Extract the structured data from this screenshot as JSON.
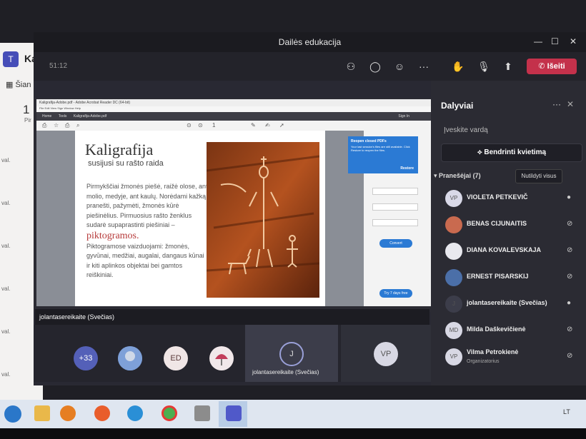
{
  "background_app": {
    "logo_icon": "teams-logo-icon",
    "title_fragment": "Ka",
    "nav_label": "Šian",
    "date_number": "1",
    "weekday_fragment": "Pir",
    "time_labels": [
      "val.",
      "val.",
      "val.",
      "val.",
      "val.",
      "val."
    ]
  },
  "meeting": {
    "window_title": "Dailės edukacija",
    "timer": "51:12",
    "leave_label": "Išeiti",
    "toolbar_icons": [
      "people-icon",
      "chat-icon",
      "reactions-icon",
      "more-icon",
      "raise-hand-icon",
      "mic-icon",
      "share-icon"
    ]
  },
  "shared_screen": {
    "acrobat_title": "Kaligrafija-Adobe.pdf - Adobe Acrobat Reader DC (64-bit)",
    "acrobat_menu": "File  Edit  View  Sign  Window  Help",
    "tabs": [
      "Home",
      "Tools",
      "Kaligrafija-Adobe.pdf"
    ],
    "sign_in": "Sign In",
    "page_indicator": "1",
    "slide": {
      "title": "Kaligrafija",
      "subtitle": "susijusi su rašto raida",
      "paragraph1": "Pirmykščiai žmonės piešė, raižė olose, ant molio, medyje, ant kaulų. Norėdami kažką pranešti, pažymėti, žmonės kūrė piešinėlius. Pirmuosius rašto ženklus sudarė supaprastinti piešiniai –",
      "highlight": "piktogramos.",
      "paragraph2": "Piktogramose vaizduojami: žmonės, gyvūnai, medžiai, augalai, dangaus kūnai ir kiti aplinkos objektai bei gamtos reiškiniai."
    },
    "popup": {
      "title": "Reopen closed PDFs",
      "body": "Your last session's files are still available. Click Restore to reopen the files.",
      "restore": "Restore"
    },
    "right_panel_button": "Convert",
    "right_panel_button2": "Try 7 days free",
    "presenter_label": "jolantasereikaite (Svečias)"
  },
  "gallery": {
    "overflow_count": "+33",
    "ed_initials": "ED",
    "active_initial": "J",
    "active_name": "jolantasereikaite (Svečias)",
    "vp_initials": "VP"
  },
  "participants": {
    "title": "Dalyviai",
    "more": "···",
    "close": "✕",
    "search_placeholder": "Įveskite vardą",
    "share_invite": "Bendrinti kvietimą",
    "presenters_header": "Pranešėjai (7)",
    "mute_all": "Nutildyti visus",
    "people": [
      {
        "initials": "VP",
        "name": "VIOLETA PETKEVIČ",
        "role": "",
        "mic": "mic-on-icon",
        "avatar_color": "#d9d9e8"
      },
      {
        "initials": "",
        "name": "BENAS CIJUNAITIS",
        "role": "",
        "mic": "mic-off-icon",
        "avatar_color": "#c96a4f"
      },
      {
        "initials": "",
        "name": "DIANA KOVALEVSKAJA",
        "role": "",
        "mic": "mic-off-icon",
        "avatar_color": "#e8e8ee"
      },
      {
        "initials": "",
        "name": "ERNEST PISARSKIJ",
        "role": "",
        "mic": "mic-off-icon",
        "avatar_color": "#4b6fa8"
      },
      {
        "initials": "J",
        "name": "jolantasereikaite (Svečias)",
        "role": "",
        "mic": "mic-on-icon",
        "avatar_color": "#3c3d4a"
      },
      {
        "initials": "MD",
        "name": "Milda Daškevičienė",
        "role": "",
        "mic": "mic-off-icon",
        "avatar_color": "#d8d8e4"
      },
      {
        "initials": "VP",
        "name": "Vilma Petrokienė",
        "role": "Organizatorius",
        "mic": "mic-off-icon",
        "avatar_color": "#d8d8e4"
      }
    ]
  },
  "taskbar": {
    "language": "LT",
    "apps": [
      "file-explorer-icon",
      "media-player-icon",
      "firefox-icon",
      "edge-icon",
      "chrome-icon",
      "calculator-icon",
      "teams-icon"
    ]
  }
}
